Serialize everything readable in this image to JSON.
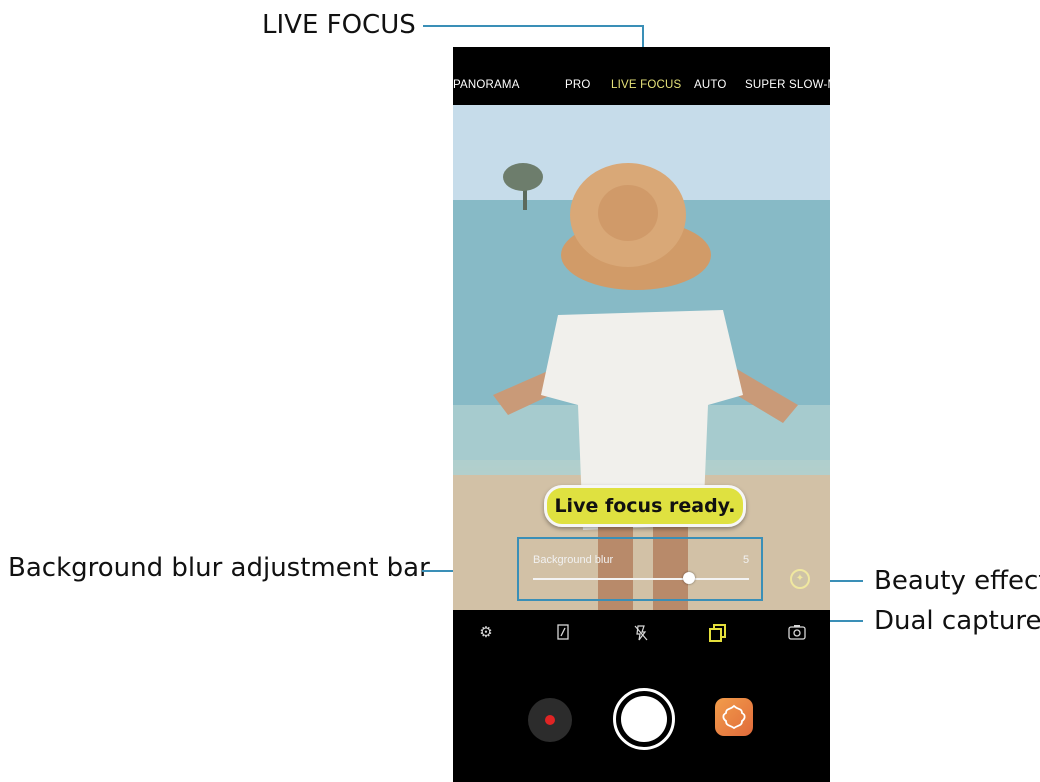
{
  "callouts": {
    "live_focus": "LIVE FOCUS",
    "background_blur_bar": "Background blur adjustment bar",
    "beauty_effect": "Beauty effect",
    "dual_capture": "Dual capture"
  },
  "modes": [
    "PANORAMA",
    "PRO",
    "LIVE FOCUS",
    "AUTO",
    "SUPER SLOW-M"
  ],
  "active_mode": "LIVE FOCUS",
  "toast": "Live focus ready.",
  "blur": {
    "label": "Background blur",
    "value": "5",
    "level_fraction": 0.72
  },
  "colors": {
    "callout_line": "#3a8fb7",
    "active_mode": "#e6e27a",
    "toast_bg": "#dfe140",
    "record_dot": "#e02424",
    "gallery_icon": "#e8753f"
  },
  "controls": [
    "settings-icon",
    "ratio-icon",
    "flash-off-icon",
    "dual-capture-icon",
    "switch-camera-icon"
  ]
}
